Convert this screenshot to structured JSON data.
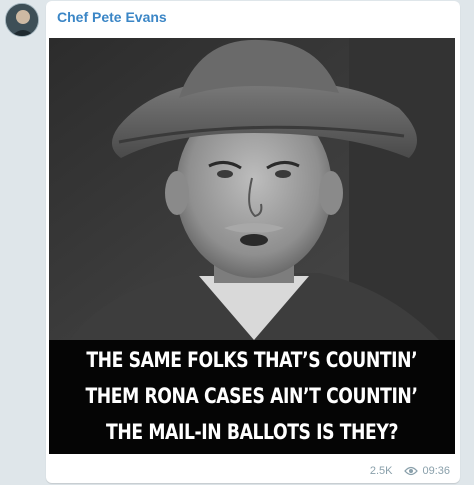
{
  "post": {
    "author": "Chef Pete Evans",
    "caption_lines": [
      "THE SAME FOLKS THAT’S COUNTIN’",
      "THEM RONA CASES AIN’T COUNTIN’",
      "THE MAIL-IN BALLOTS IS THEY?"
    ],
    "views": "2.5K",
    "time": "09:36"
  },
  "icons": {
    "views": "eye-icon"
  },
  "colors": {
    "author": "#3b86c6",
    "meta": "#8aa0ab",
    "background": "#dfe6ea",
    "bubble": "#ffffff"
  }
}
